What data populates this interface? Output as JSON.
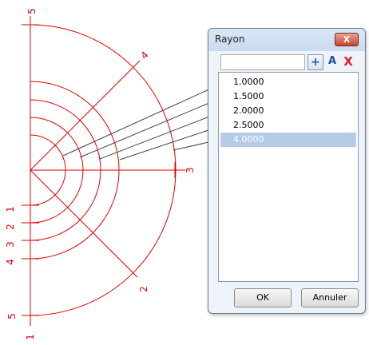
{
  "drawing": {
    "color": "#e00000",
    "axis_labels": {
      "vertical_top": "5",
      "diagonal_upper": "4",
      "horizontal": "3",
      "diagonal_lower": "2",
      "vertical_bottom": "5",
      "bottom_end": "1"
    },
    "radius_markers": [
      "1",
      "2",
      "3",
      "4"
    ],
    "leader_line_color": "#404040"
  },
  "dialog": {
    "title": "Rayon",
    "close_glyph": "X",
    "input_value": "",
    "add_glyph": "+",
    "rename_glyph": "A",
    "delete_glyph": "X",
    "items": [
      "1.0000",
      "1.5000",
      "2.0000",
      "2.5000",
      "4.0000"
    ],
    "selected_index": 4,
    "ok_label": "OK",
    "cancel_label": "Annuler"
  }
}
